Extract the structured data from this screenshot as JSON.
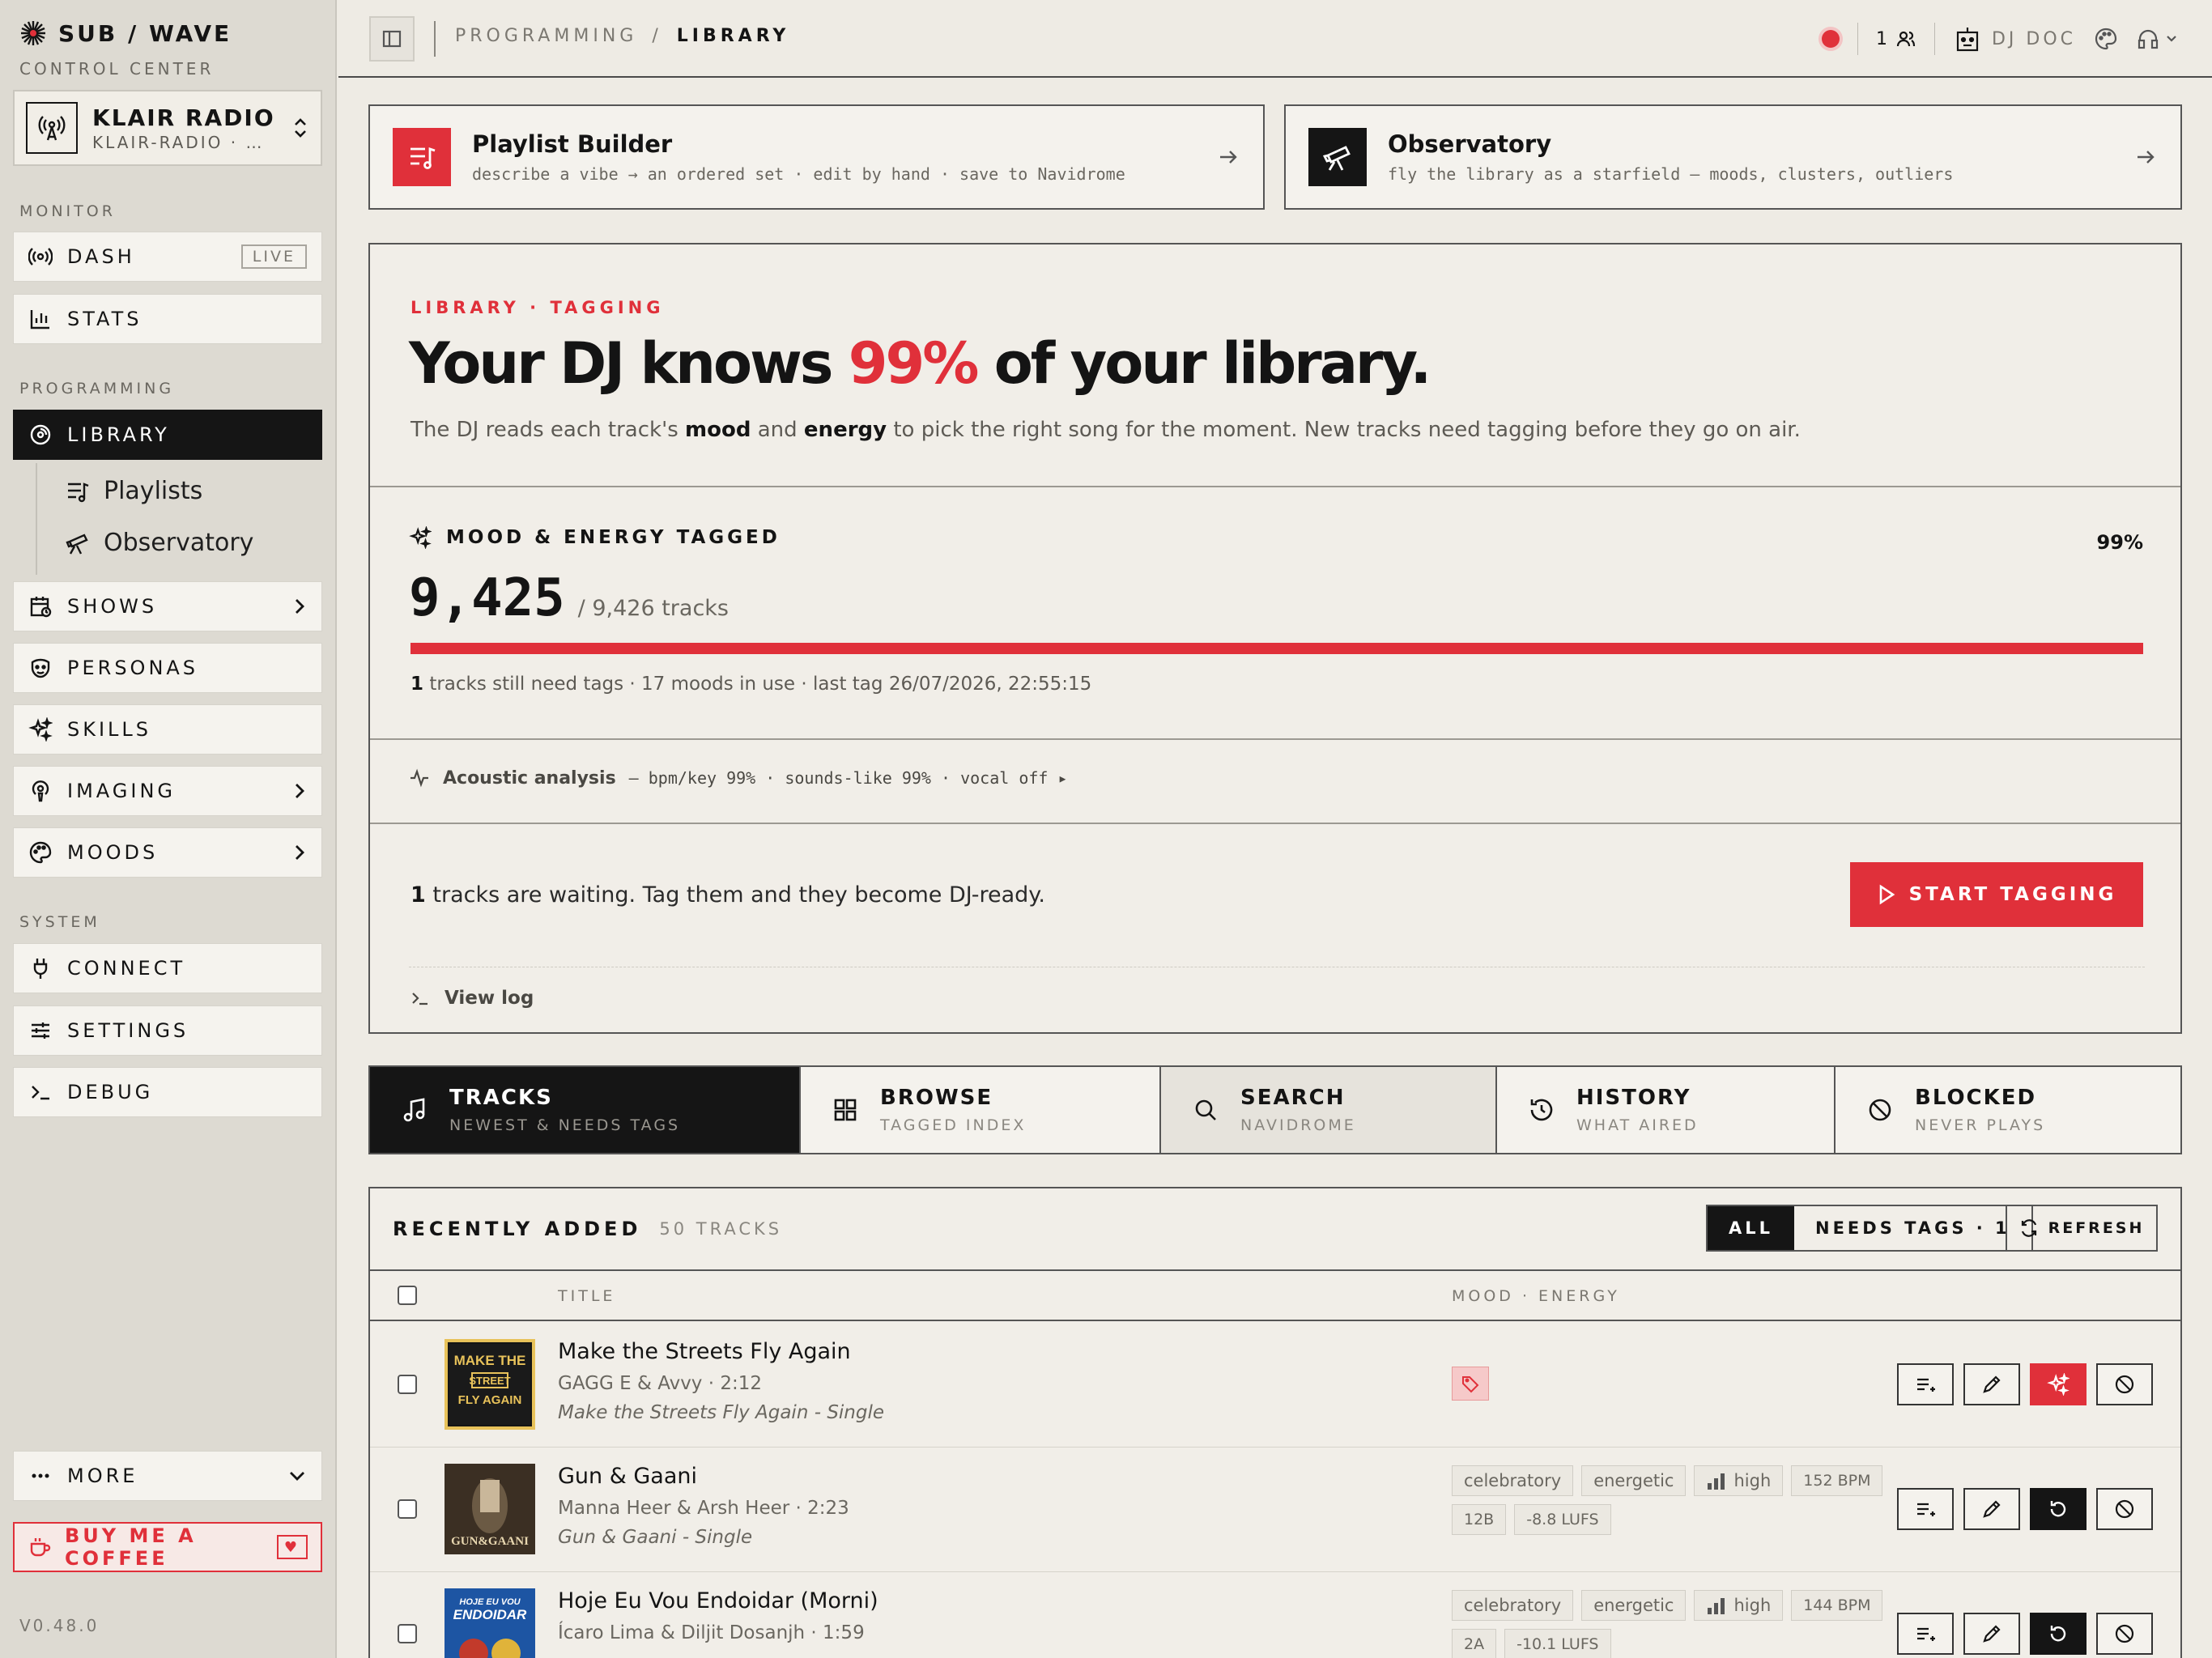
{
  "brand": {
    "name": "SUB / WAVE",
    "subtitle": "CONTROL CENTER"
  },
  "station": {
    "name": "KLAIR RADIO",
    "slug": "KLAIR-RADIO · …"
  },
  "sidebar": {
    "monitor_label": "MONITOR",
    "dash": "DASH",
    "live_badge": "LIVE",
    "stats": "STATS",
    "programming_label": "PROGRAMMING",
    "library": "LIBRARY",
    "playlists": "Playlists",
    "observatory": "Observatory",
    "shows": "SHOWS",
    "personas": "PERSONAS",
    "skills": "SKILLS",
    "imaging": "IMAGING",
    "moods": "MOODS",
    "system_label": "SYSTEM",
    "connect": "CONNECT",
    "settings": "SETTINGS",
    "debug": "DEBUG",
    "more": "MORE",
    "coffee": "BUY ME A COFFEE",
    "version": "V0.48.0"
  },
  "topbar": {
    "crumb_parent": "PROGRAMMING",
    "crumb_sep": "/",
    "crumb_current": "LIBRARY",
    "listeners": "1",
    "dj_name": "DJ DOC"
  },
  "cards": {
    "playlist": {
      "title": "Playlist Builder",
      "subtitle": "describe a vibe → an ordered set · edit by hand · save to Navidrome"
    },
    "observatory": {
      "title": "Observatory",
      "subtitle": "fly the library as a starfield — moods, clusters, outliers"
    }
  },
  "hero": {
    "eyebrow": "LIBRARY · TAGGING",
    "headline_pre": "Your DJ knows ",
    "headline_pct": "99%",
    "headline_post": " of your library.",
    "lede_1": "The DJ reads each track's ",
    "lede_mood": "mood",
    "lede_2": " and ",
    "lede_energy": "energy",
    "lede_3": " to pick the right song for the moment. New tracks need tagging before they go on air.",
    "mood_title": "MOOD & ENERGY TAGGED",
    "percent": "99%",
    "tagged_count": "9,425",
    "total": "/ 9,426 tracks",
    "progress": 0.9999,
    "meta_count": "1",
    "meta_rest": " tracks still need tags · 17 moods in use · last tag 26/07/2026, 22:55:15",
    "acoustic_label": "Acoustic analysis",
    "acoustic_detail": "— bpm/key 99% · sounds-like 99% · vocal off ▸",
    "waiting_count": "1",
    "waiting_rest": " tracks are waiting. Tag them and they become DJ-ready.",
    "start_button": "START TAGGING",
    "view_log": "View log"
  },
  "tabs": [
    {
      "title": "TRACKS",
      "sub": "NEWEST & NEEDS TAGS"
    },
    {
      "title": "BROWSE",
      "sub": "TAGGED INDEX"
    },
    {
      "title": "SEARCH",
      "sub": "NAVIDROME"
    },
    {
      "title": "HISTORY",
      "sub": "WHAT AIRED"
    },
    {
      "title": "BLOCKED",
      "sub": "NEVER PLAYS"
    }
  ],
  "tracks_panel": {
    "title": "RECENTLY ADDED",
    "count": "50 TRACKS",
    "filter_all": "ALL",
    "filter_needs": "NEEDS TAGS · 1",
    "refresh": "REFRESH",
    "col_title": "TITLE",
    "col_mood": "MOOD · ENERGY"
  },
  "rows": [
    {
      "title": "Make the Streets Fly Again",
      "artist": "GAGG E & Avvy · 2:12",
      "album": "Make the Streets Fly Again - Single",
      "art_text": "MAKE THE STREET FLY AGAIN"
    },
    {
      "title": "Gun & Gaani",
      "artist": "Manna Heer & Arsh Heer · 2:23",
      "album": "Gun & Gaani - Single",
      "art_text": "GUN&GAANI",
      "tags": [
        "celebratory",
        "energetic",
        "high",
        "152 BPM",
        "12B",
        "-8.8 LUFS"
      ]
    },
    {
      "title": "Hoje Eu Vou Endoidar (Morni)",
      "artist": "Ícaro Lima & Diljit Dosanjh · 1:59",
      "album": "",
      "art_text": "HOJE EU VOU ENDOIDAR",
      "tags": [
        "celebratory",
        "energetic",
        "high",
        "144 BPM",
        "2A",
        "-10.1 LUFS"
      ]
    }
  ],
  "colors": {
    "accent": "#e0303a",
    "ink": "#141414",
    "paper": "#eeebe4"
  }
}
